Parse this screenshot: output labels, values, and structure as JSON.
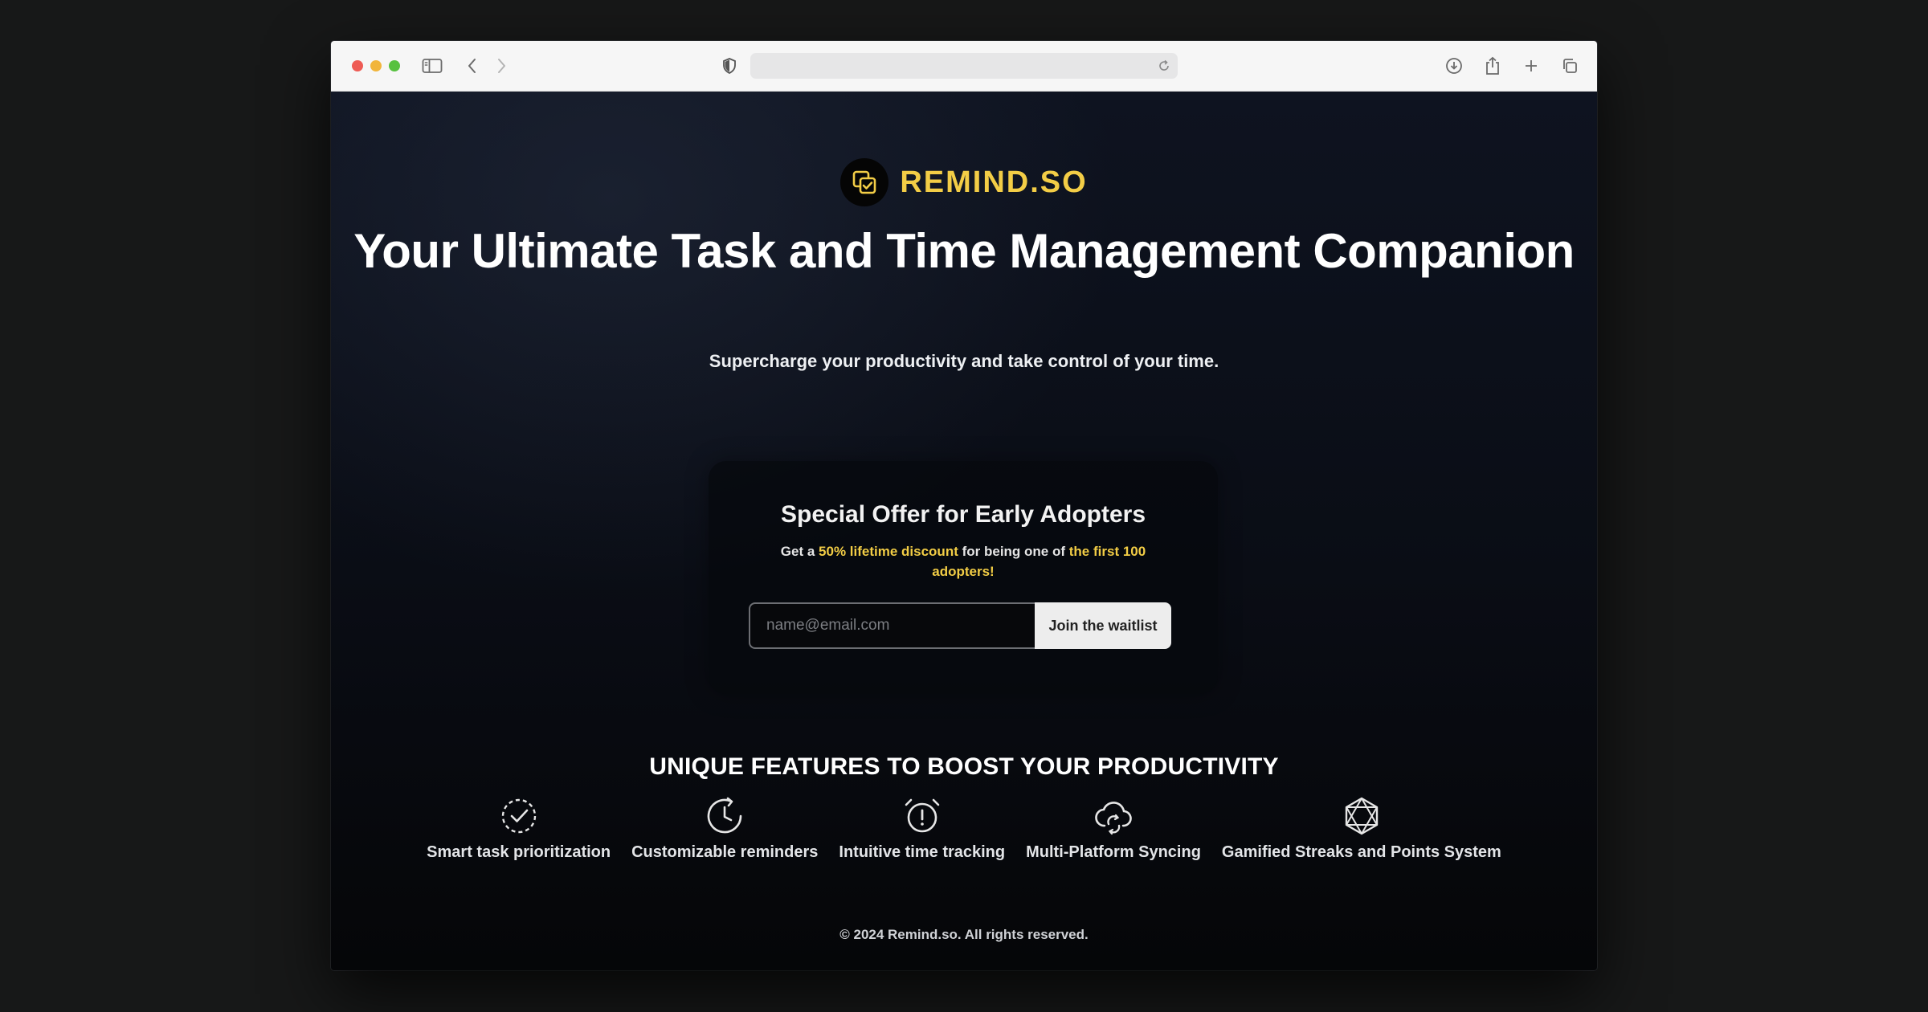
{
  "brand": {
    "name": "REMIND.SO",
    "accent_color": "#f3cd46",
    "logo_icon": "copy-check-icon"
  },
  "hero": {
    "title": "Your Ultimate Task and Time Management Companion",
    "subtitle": "Supercharge your productivity and take control of your time."
  },
  "offer": {
    "title": "Special Offer for Early Adopters",
    "text_1": "Get a ",
    "highlight_1": "50% lifetime discount",
    "text_2": " for being one of ",
    "highlight_2": "the first 100 adopters!",
    "email_placeholder": "name@email.com",
    "email_value": "",
    "button_label": "Join the waitlist"
  },
  "features": {
    "title": "UNIQUE FEATURES TO BOOST YOUR PRODUCTIVITY",
    "items": [
      {
        "label": "Smart task prioritization",
        "icon": "dashed-circle-check-icon"
      },
      {
        "label": "Customizable reminders",
        "icon": "clock-rotate-icon"
      },
      {
        "label": "Intuitive time tracking",
        "icon": "alarm-clock-alert-icon"
      },
      {
        "label": "Multi-Platform Syncing",
        "icon": "cloud-sync-icon"
      },
      {
        "label": "Gamified Streaks and Points System",
        "icon": "star-polygon-icon"
      }
    ]
  },
  "footer": {
    "text": "© 2024 Remind.so. All rights reserved."
  },
  "browser": {
    "traffic_lights": [
      "#ee5b54",
      "#f1b53b",
      "#57c13f"
    ]
  }
}
